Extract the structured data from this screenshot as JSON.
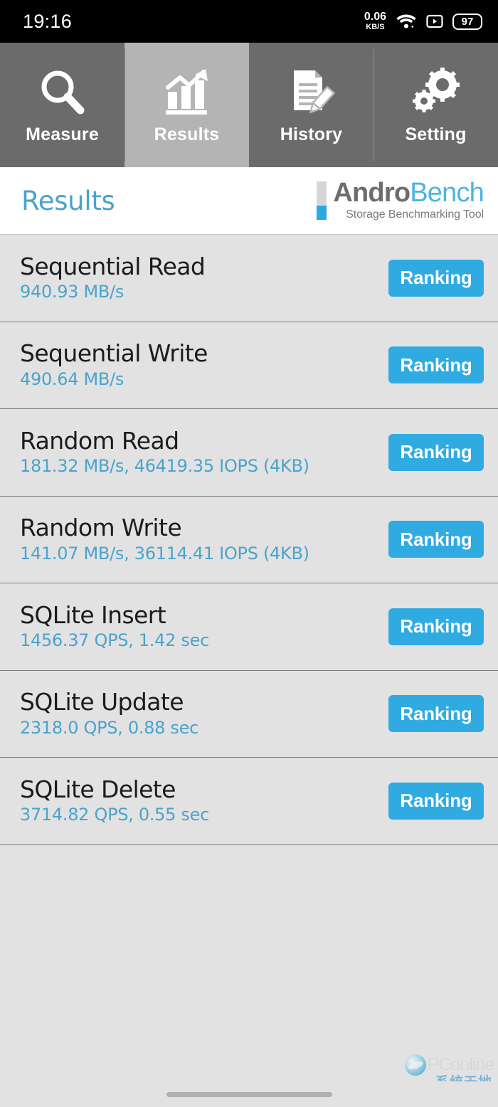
{
  "statusbar": {
    "clock": "19:16",
    "network_rate": "0.06",
    "network_unit": "KB/S",
    "wifi_icon": "wifi-icon",
    "cast_icon": "screen-record-icon",
    "battery_level": "97"
  },
  "tabs": [
    {
      "label": "Measure",
      "icon": "magnifier-icon",
      "active": false
    },
    {
      "label": "Results",
      "icon": "bar-chart-arrow-icon",
      "active": true
    },
    {
      "label": "History",
      "icon": "document-pencil-icon",
      "active": false
    },
    {
      "label": "Setting",
      "icon": "gears-icon",
      "active": false
    }
  ],
  "header": {
    "page_title": "Results",
    "logo_word_a": "Andro",
    "logo_word_b": "Bench",
    "logo_tagline": "Storage Benchmarking Tool"
  },
  "results": {
    "ranking_label": "Ranking",
    "rows": [
      {
        "title": "Sequential Read",
        "value": "940.93 MB/s"
      },
      {
        "title": "Sequential Write",
        "value": "490.64 MB/s"
      },
      {
        "title": "Random Read",
        "value": "181.32 MB/s, 46419.35 IOPS (4KB)"
      },
      {
        "title": "Random Write",
        "value": "141.07 MB/s, 36114.41 IOPS (4KB)"
      },
      {
        "title": "SQLite Insert",
        "value": "1456.37 QPS, 1.42 sec"
      },
      {
        "title": "SQLite Update",
        "value": "2318.0 QPS, 0.88 sec"
      },
      {
        "title": "SQLite Delete",
        "value": "3714.82 QPS, 0.55 sec"
      }
    ]
  },
  "watermark": {
    "brand": "PConline",
    "cn_text": "系统天地"
  },
  "colors": {
    "accent_blue": "#2fabe2",
    "value_blue": "#4aa3cc",
    "list_bg": "#e2e2e2",
    "tab_inactive": "#6b6b6b",
    "tab_active": "#b4b4b4"
  }
}
